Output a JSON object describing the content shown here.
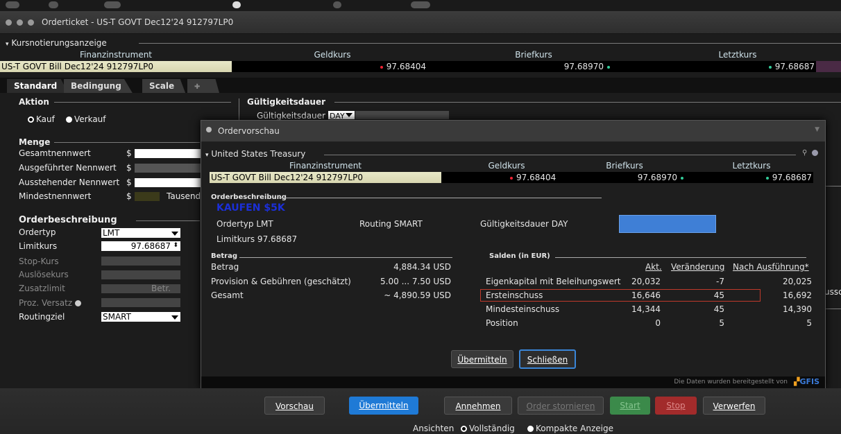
{
  "window": {
    "title": "Orderticket - US-T GOVT Dec12'24 912797LP0"
  },
  "quote": {
    "section": "Kursnotierungsanzeige",
    "headers": [
      "Finanzinstrument",
      "Geldkurs",
      "Briefkurs",
      "Letztkurs"
    ],
    "instrument": "US-T GOVT Bill Dec12'24 912797LP0",
    "bid": "97.68404",
    "ask": "97.68970",
    "last": "97.68687"
  },
  "tabs": [
    "Standard",
    "Bedingung",
    "Scale"
  ],
  "aktion": {
    "header": "Aktion",
    "kauf": "Kauf",
    "verkauf": "Verkauf"
  },
  "gueltigkeit": {
    "header": "Gültigkeitsdauer",
    "label": "Gültigkeitsdauer",
    "value": "DAY"
  },
  "menge": {
    "header": "Menge",
    "rows": [
      "Gesamtnennwert",
      "Ausgeführter Nennwert",
      "Ausstehender Nennwert",
      "Mindestnennwert"
    ],
    "currency": "$",
    "tausend": "Tausend"
  },
  "orderbeschreibung": {
    "header": "Orderbeschreibung",
    "ordertyp_label": "Ordertyp",
    "ordertyp": "LMT",
    "limitkurs_label": "Limitkurs",
    "limitkurs": "97.68687",
    "stop_label": "Stop-Kurs",
    "ausloese_label": "Auslösekurs",
    "zusatzlimit_label": "Zusatzlimit",
    "zusatzlimit_placeholder": "Betr.",
    "versatz_label": "Proz. Versatz",
    "routing_label": "Routingziel",
    "routing": "SMART"
  },
  "dialog": {
    "title": "Ordervorschau",
    "section": "United States Treasury",
    "headers": [
      "Finanzinstrument",
      "Geldkurs",
      "Briefkurs",
      "Letztkurs"
    ],
    "instrument": "US-T GOVT Bill Dec12'24 912797LP0",
    "bid": "97.68404",
    "ask": "97.68970",
    "last": "97.68687",
    "desc_header": "Orderbeschreibung",
    "headline": "KAUFEN $5K",
    "ordertyp": "Ordertyp LMT",
    "routing": "Routing SMART",
    "gueltigkeit": "Gültigkeitsdauer DAY",
    "limitkurs": "Limitkurs 97.68687",
    "betrag_header": "Betrag",
    "betrag_rows": [
      {
        "label": "Betrag",
        "value": "4,884.34 USD"
      },
      {
        "label": "Provision & Gebühren (geschätzt)",
        "value": "5.00 ... 7.50 USD"
      },
      {
        "label": "Gesamt",
        "value": "~ 4,890.59 USD"
      }
    ],
    "salden_header": "Salden (in EUR)",
    "salden_cols": [
      "Akt.",
      "Veränderung",
      "Nach Ausführung*"
    ],
    "salden_rows": [
      {
        "label": "Eigenkapital mit Beleihungswert",
        "akt": "20,032",
        "chg": "-7",
        "after": "20,025"
      },
      {
        "label": "Ersteinschuss",
        "akt": "16,646",
        "chg": "45",
        "after": "16,692"
      },
      {
        "label": "Mindesteinschuss",
        "akt": "14,344",
        "chg": "45",
        "after": "14,390"
      },
      {
        "label": "Position",
        "akt": "0",
        "chg": "5",
        "after": "5"
      }
    ],
    "submit": "Übermitteln",
    "close": "Schließen",
    "footer": "Die Daten wurden bereitgestellt von",
    "brand": "GFIS"
  },
  "bottom": {
    "buttons": [
      "Vorschau",
      "Übermitteln",
      "Annehmen",
      "Order stornieren",
      "Start",
      "Stop",
      "Verwerfen"
    ],
    "ansichten": "Ansichten",
    "vollstaendig": "Vollständig",
    "kompakt": "Kompakte Anzeige"
  },
  "side_text": "ussc",
  "colors": {
    "blue": "#1f7ad6",
    "red_highlight": "#c0392b",
    "headline": "#1b2fd8"
  }
}
